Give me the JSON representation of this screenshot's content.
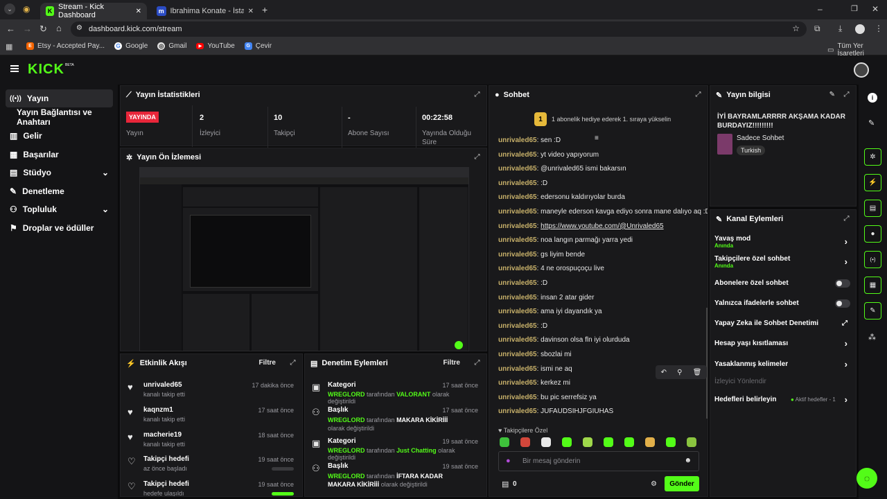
{
  "browser": {
    "tabs": [
      {
        "label": "Stream - Kick Dashboard"
      },
      {
        "label": "Ibrahima Konate - İstatistik, Ma"
      }
    ],
    "url": "dashboard.kick.com/stream",
    "bookmarks": [
      "Etsy - Accepted Pay...",
      "Google",
      "Gmail",
      "YouTube",
      "Çevir"
    ],
    "all_bookmarks": "Tüm Yer İşaretleri"
  },
  "header": {
    "logo": "KICK",
    "beta": "BETA"
  },
  "sidebar": {
    "items": [
      {
        "label": "Yayın",
        "icon": "broadcast-icon"
      },
      {
        "label": "Yayın Bağlantısı ve Anahtarı",
        "icon": ""
      },
      {
        "label": "Gelir",
        "icon": "chart-icon"
      },
      {
        "label": "Başarılar",
        "icon": "grid-icon"
      },
      {
        "label": "Stüdyo",
        "icon": "studio-icon"
      },
      {
        "label": "Denetleme",
        "icon": "wrench-icon"
      },
      {
        "label": "Topluluk",
        "icon": "people-icon"
      },
      {
        "label": "Droplar ve ödüller",
        "icon": "gift-icon"
      }
    ]
  },
  "stats": {
    "title": "Yayın İstatistikleri",
    "live_badge": "YAYINDA",
    "live_label": "Yayın",
    "items": [
      {
        "value": "2",
        "label": "İzleyici"
      },
      {
        "value": "10",
        "label": "Takipçi"
      },
      {
        "value": "-",
        "label": "Abone Sayısı"
      },
      {
        "value": "00:22:58",
        "label": "Yayında Olduğu Süre"
      }
    ]
  },
  "preview": {
    "title": "Yayın Ön İzlemesi"
  },
  "activity": {
    "title": "Etkinlik Akışı",
    "filter": "Filtre",
    "items": [
      {
        "title": "unrivaled65",
        "sub": "kanalı takip etti",
        "time": "17 dakika önce"
      },
      {
        "title": "kaqnzm1",
        "sub": "kanalı takip etti",
        "time": "17 saat önce"
      },
      {
        "title": "macherie19",
        "sub": "kanalı takip etti",
        "time": "18 saat önce"
      },
      {
        "title": "Takipçi hedefi",
        "sub": "az önce başladı",
        "time": "19 saat önce"
      },
      {
        "title": "Takipçi hedefi",
        "sub": "hedefe ulaşıldı",
        "time": "19 saat önce"
      }
    ]
  },
  "moderation": {
    "title": "Denetim Eylemleri",
    "filter": "Filtre",
    "items": [
      {
        "title": "Kategori",
        "user": "WREGLORD",
        "mid": "tarafından",
        "value": "VALORANT",
        "end": "olarak değiştirildi",
        "time": "17 saat önce"
      },
      {
        "title": "Başlık",
        "user": "WREGLORD",
        "mid": "tarafından",
        "value": "MAKARA KİKİRİİİ",
        "end": "olarak değiştirildi",
        "time": "17 saat önce"
      },
      {
        "title": "Kategori",
        "user": "WREGLORD",
        "mid": "tarafından",
        "value": "Just Chatting",
        "end": "olarak değiştirildi",
        "time": "19 saat önce"
      },
      {
        "title": "Başlık",
        "user": "WREGLORD",
        "mid": "tarafından",
        "value": "İFTARA KADAR MAKARA KİKİRİİİ",
        "end": "olarak değiştirildi",
        "time": "19 saat önce"
      }
    ]
  },
  "chat": {
    "title": "Sohbet",
    "gift_count": "1",
    "gift_text": "1 abonelik hediye ederek 1. sıraya yükselin",
    "messages": [
      {
        "user": "unrivaled65",
        "text": "sen :D"
      },
      {
        "user": "unrivaled65",
        "text": "yt video yapıyorum"
      },
      {
        "user": "unrivaled65",
        "text": "@unrivaled65 ismi bakarsın"
      },
      {
        "user": "unrivaled65",
        "text": ":D"
      },
      {
        "user": "unrivaled65",
        "text": "edersonu kaldırıyolar burda"
      },
      {
        "user": "unrivaled65",
        "text": "maneyle ederson kavga ediyo sonra mane dalıyo aq :D"
      },
      {
        "user": "unrivaled65",
        "text": "https://www.youtube.com/@Unrivaled65"
      },
      {
        "user": "unrivaled65",
        "text": "noa langın parmağı yarra yedi"
      },
      {
        "user": "unrivaled65",
        "text": "gs liyim bende"
      },
      {
        "user": "unrivaled65",
        "text": "4 ne orospuçoçu live"
      },
      {
        "user": "unrivaled65",
        "text": ":D"
      },
      {
        "user": "unrivaled65",
        "text": "insan 2 atar gider"
      },
      {
        "user": "unrivaled65",
        "text": "ama iyi dayandık ya"
      },
      {
        "user": "unrivaled65",
        "text": ":D"
      },
      {
        "user": "unrivaled65",
        "text": "davinson olsa fln iyi olurduda"
      },
      {
        "user": "unrivaled65",
        "text": "sbozlai mi"
      },
      {
        "user": "unrivaled65",
        "text": "ismi ne aq"
      },
      {
        "user": "unrivaled65",
        "text": "kerkez mi"
      },
      {
        "user": "unrivaled65",
        "text": "bu pic serrefsiz ya"
      },
      {
        "user": "unrivaled65",
        "text": "JUFAUDSIHJFGIUHAS"
      }
    ],
    "followers_only": "Takipçilere Özel",
    "placeholder": "Bir mesaj gönderin",
    "count": "0",
    "send": "Gönder"
  },
  "info": {
    "title": "Yayın bilgisi",
    "stream_title": "İYİ BAYRAMLARRRR AKŞAMA KADAR BURDAYIZ!!!!!!!!!",
    "category": "Sadece Sohbet",
    "language": "Turkish"
  },
  "channel_actions": {
    "title": "Kanal Eylemleri",
    "items": [
      {
        "label": "Yavaş mod",
        "sub": "Anında"
      },
      {
        "label": "Takipçilere özel sohbet",
        "sub": "Anında"
      },
      {
        "label": "Abonelere özel sohbet",
        "sub": ""
      },
      {
        "label": "Yalnızca ifadelerle sohbet",
        "sub": ""
      },
      {
        "label": "Yapay Zeka ile Sohbet Denetimi",
        "sub": ""
      },
      {
        "label": "Hesap yaşı kısıtlaması",
        "sub": ""
      },
      {
        "label": "Yasaklanmış kelimeler",
        "sub": ""
      },
      {
        "label": "İzleyici Yönlendir",
        "sub": ""
      },
      {
        "label": "Hedefleri belirleyin",
        "sub": "Aktif hedefler - 1"
      }
    ]
  },
  "colors": {
    "accent": "#53fc18",
    "username": "#c8b16a",
    "panel": "#19191b"
  }
}
